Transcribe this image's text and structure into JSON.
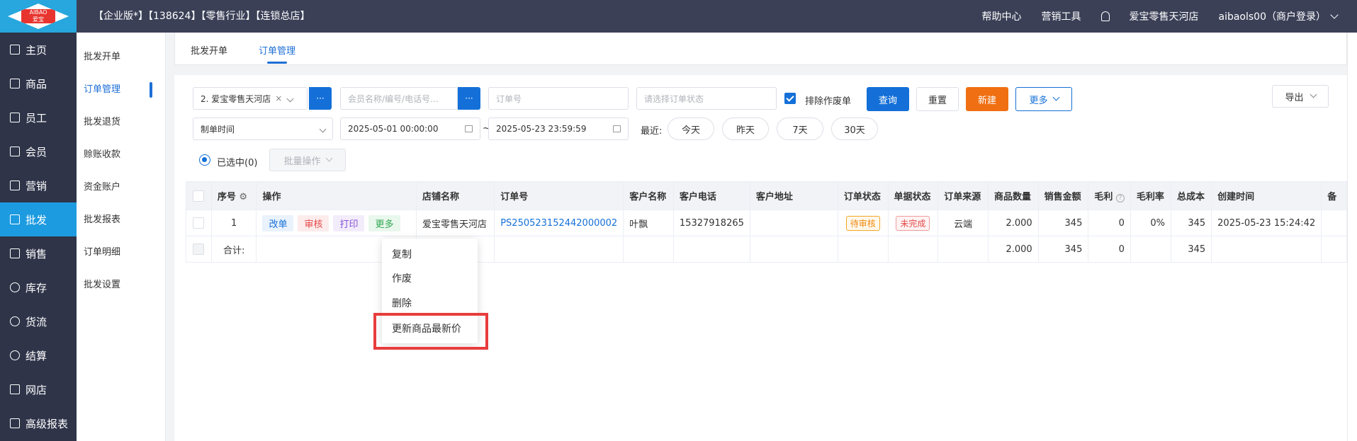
{
  "app": {
    "logo_text_top": "AIBAO",
    "logo_text_bottom": "爱宝",
    "title": "【企业版*】【138624】【零售行业】【连锁总店】"
  },
  "header": {
    "help": "帮助中心",
    "marketing": "营销工具",
    "store": "爱宝零售天河店",
    "user": "aibaols00（商户登录）"
  },
  "sidebar": {
    "items": [
      {
        "label": "主页",
        "icon": "home-icon"
      },
      {
        "label": "商品",
        "icon": "goods-icon"
      },
      {
        "label": "员工",
        "icon": "staff-icon"
      },
      {
        "label": "会员",
        "icon": "member-icon"
      },
      {
        "label": "营销",
        "icon": "megaphone-icon"
      },
      {
        "label": "批发",
        "icon": "wholesale-icon"
      },
      {
        "label": "销售",
        "icon": "bar-chart-icon"
      },
      {
        "label": "库存",
        "icon": "stock-icon"
      },
      {
        "label": "货流",
        "icon": "flow-icon"
      },
      {
        "label": "结算",
        "icon": "settle-icon"
      },
      {
        "label": "网店",
        "icon": "shop-icon"
      },
      {
        "label": "高级报表",
        "icon": "line-chart-icon"
      }
    ]
  },
  "subnav": {
    "items": [
      "批发开单",
      "订单管理",
      "批发退货",
      "赊账收款",
      "资金账户",
      "批发报表",
      "订单明细",
      "批发设置"
    ]
  },
  "tabs": [
    "批发开单",
    "订单管理"
  ],
  "filters": {
    "store_select": "2. 爱宝零售天河店",
    "member_placeholder": "会员名称/编号/电话号...",
    "order_no_placeholder": "订单号",
    "status_placeholder": "请选择订单状态",
    "exclude_voided": "排除作废单",
    "query": "查询",
    "reset": "重置",
    "new": "新建",
    "more": "更多",
    "export": "导出",
    "time_type": "制单时间",
    "date_start": "2025-05-01 00:00:00",
    "date_sep": "~",
    "date_end": "2025-05-23 23:59:59",
    "recent_label": "最近:",
    "recent": [
      "今天",
      "昨天",
      "7天",
      "30天"
    ],
    "selected": "已选中(0)",
    "batch": "批量操作",
    "ellipsis": "···"
  },
  "table": {
    "headers": [
      "序号",
      "操作",
      "店铺名称",
      "订单号",
      "客户名称",
      "客户电话",
      "客户地址",
      "订单状态",
      "单据状态",
      "订单来源",
      "商品数量",
      "销售金额",
      "毛利",
      "毛利率",
      "总成本",
      "创建时间",
      "备"
    ],
    "row": {
      "index": "1",
      "ops": [
        "改单",
        "审核",
        "打印",
        "更多"
      ],
      "store": "爱宝零售天河店",
      "order_no": "PS250523152442000002",
      "customer": "叶飘",
      "phone": "15327918265",
      "address": "",
      "order_status": "待审核",
      "doc_status": "未完成",
      "source": "云端",
      "qty": "2.000",
      "amount": "345",
      "profit": "0",
      "margin": "0%",
      "cost": "345",
      "created": "2025-05-23 15:24:42"
    },
    "total": {
      "label": "合计:",
      "qty": "2.000",
      "amount": "345",
      "profit": "0",
      "cost": "345"
    }
  },
  "dropdown_menu": {
    "items": [
      "复制",
      "作废",
      "删除",
      "更新商品最新价"
    ]
  },
  "colors": {
    "topbar": "#3b4057",
    "sidebar": "#2f3449",
    "accent": "#1470d8",
    "active_nav": "#1d9be0",
    "orange": "#f06f12",
    "highlight": "#e83c3c"
  }
}
